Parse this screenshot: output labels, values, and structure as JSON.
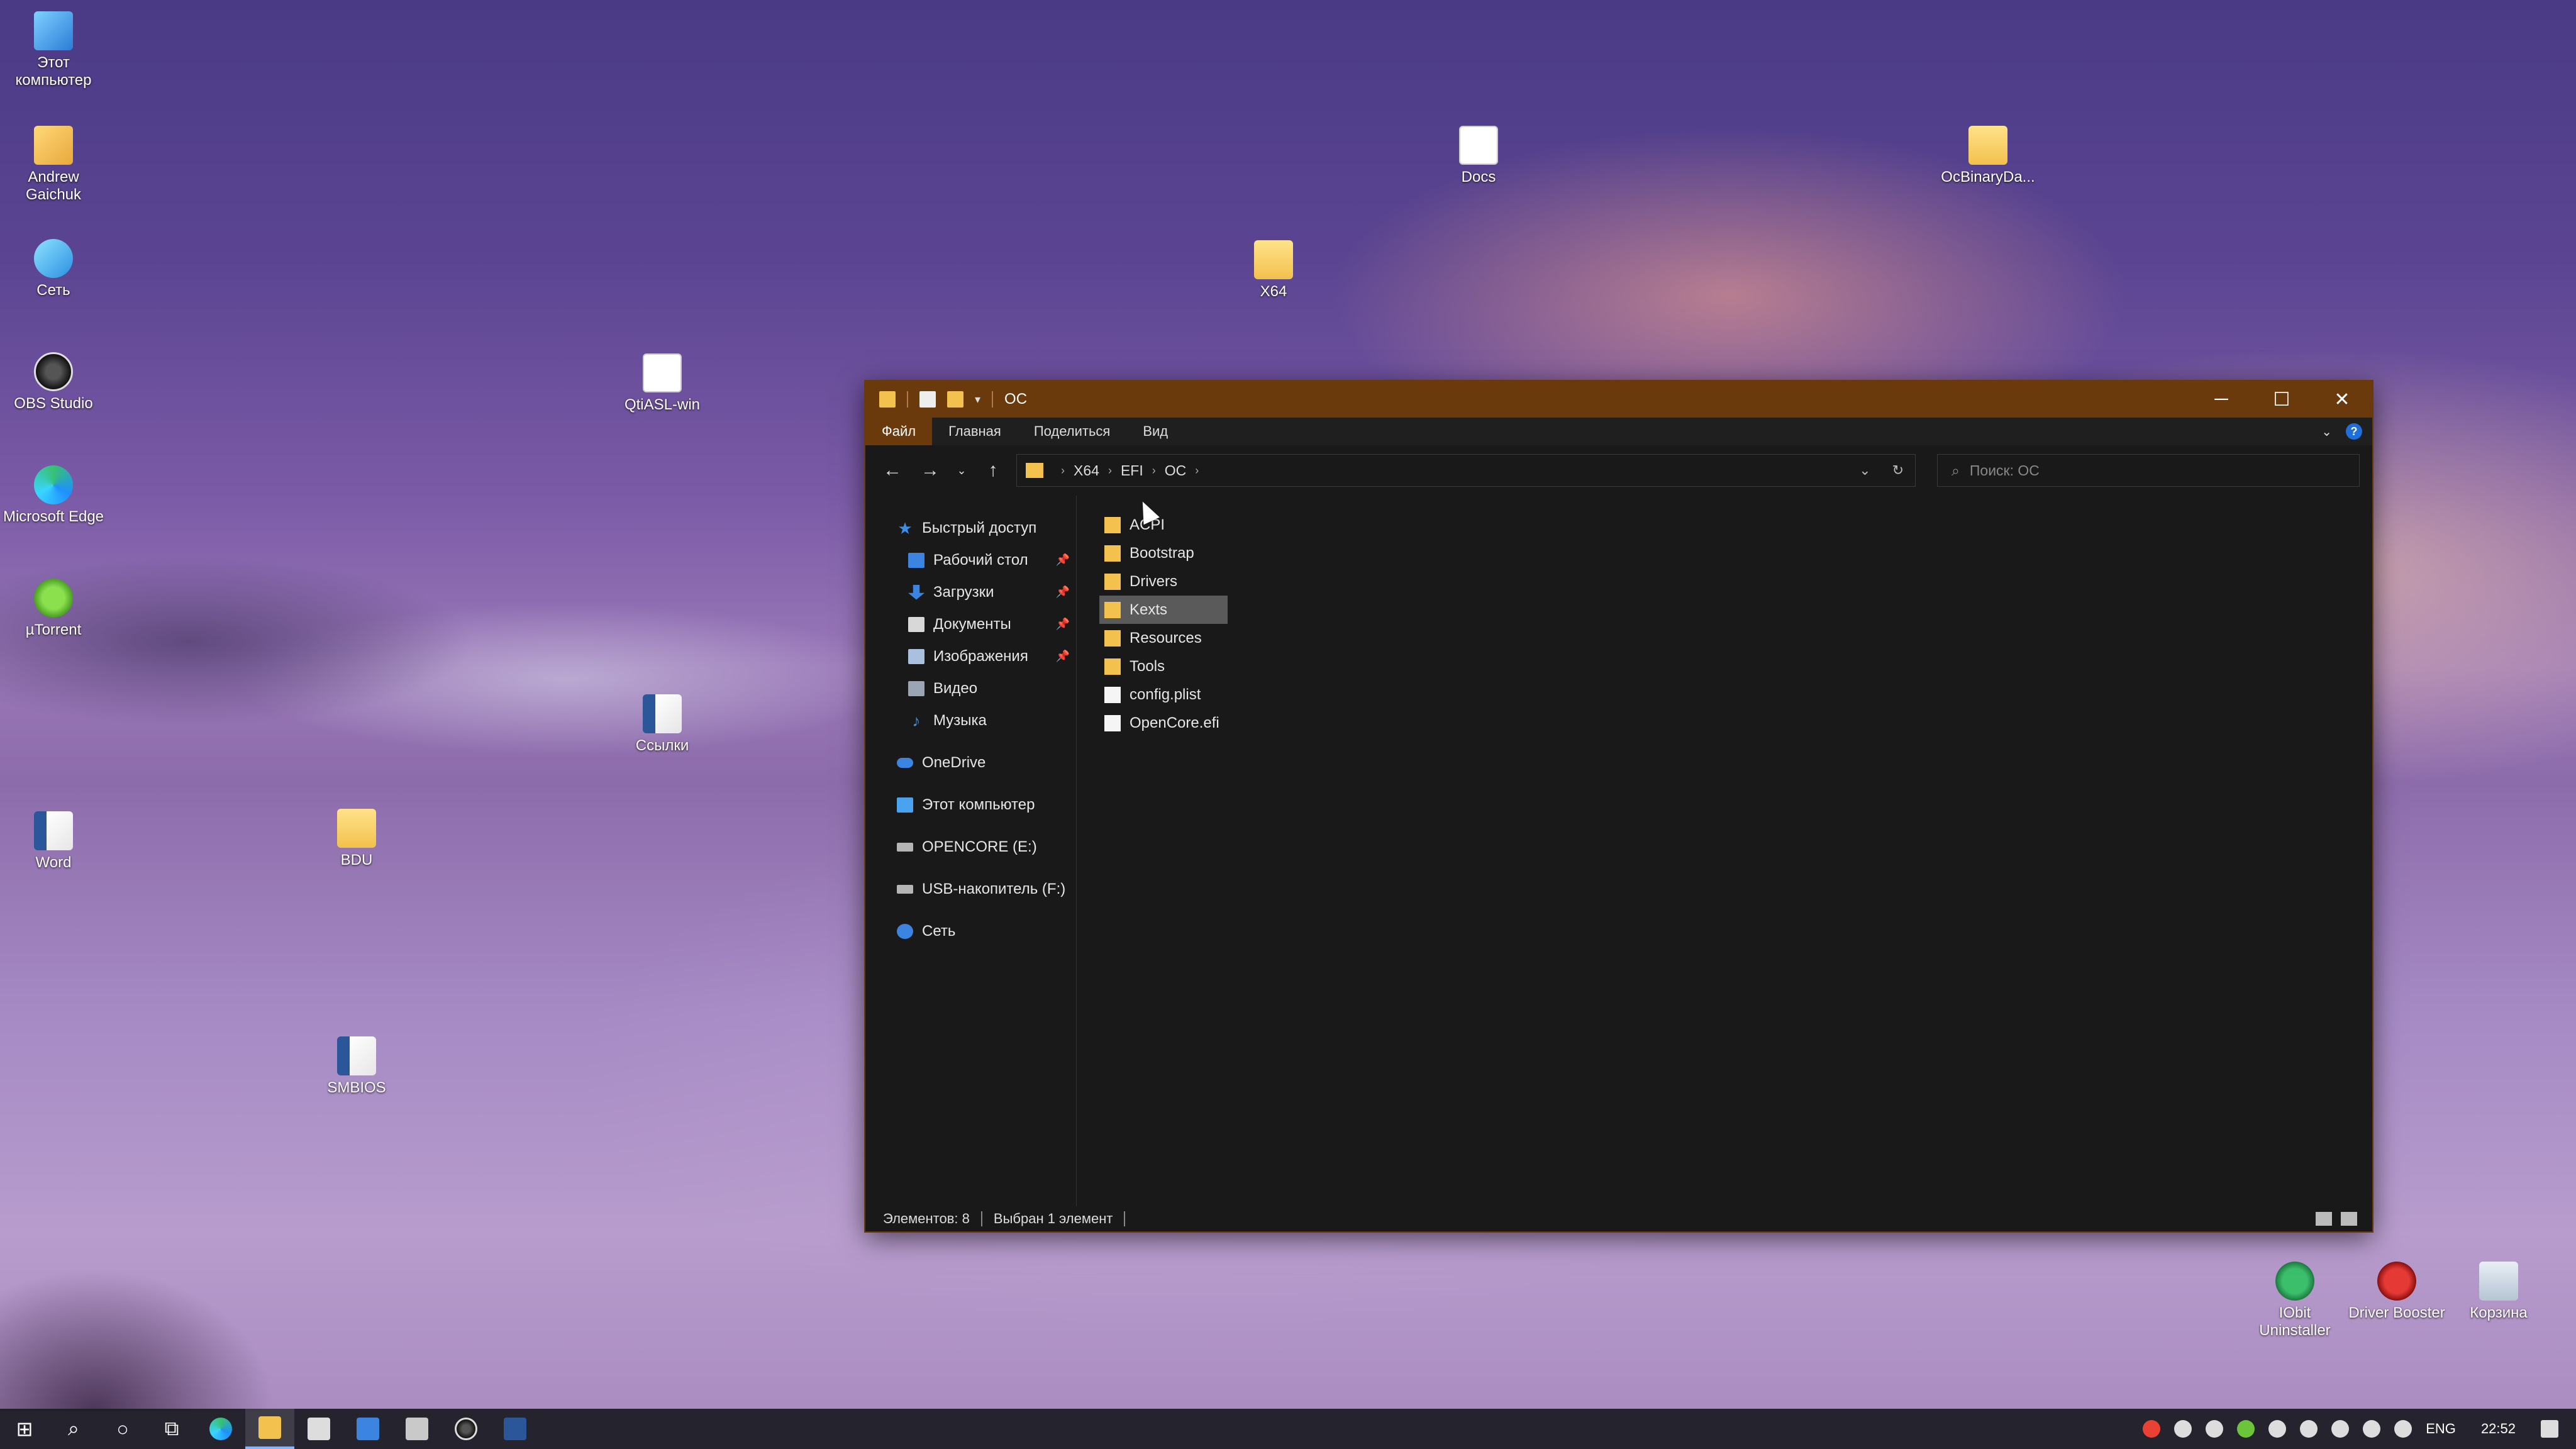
{
  "desktop": {
    "icons_left": [
      {
        "label": "Этот компьютер",
        "icon": "pc-icon"
      },
      {
        "label": "Andrew Gaichuk",
        "icon": "user-folder-icon"
      },
      {
        "label": "Сеть",
        "icon": "network-icon"
      },
      {
        "label": "OBS Studio",
        "icon": "obs-icon"
      },
      {
        "label": "Microsoft Edge",
        "icon": "edge-icon"
      },
      {
        "label": "µTorrent",
        "icon": "utorrent-icon"
      },
      {
        "label": "Word",
        "icon": "word-icon"
      }
    ],
    "icons_mid": [
      {
        "label": "QtiASL-win",
        "icon": "file-icon"
      },
      {
        "label": "Ссылки",
        "icon": "word-doc-icon"
      },
      {
        "label": "BDU",
        "icon": "folder-icon"
      },
      {
        "label": "SMBIOS",
        "icon": "word-doc-icon"
      },
      {
        "label": "X64",
        "icon": "folder-icon"
      },
      {
        "label": "Docs",
        "icon": "pdf-doc-icon"
      },
      {
        "label": "OcBinaryDa...",
        "icon": "folder-icon"
      }
    ],
    "icons_right": [
      {
        "label": "IObit Uninstaller",
        "icon": "iobit-icon"
      },
      {
        "label": "Driver Booster",
        "icon": "driver-booster-icon"
      },
      {
        "label": "Корзина",
        "icon": "recycle-bin-icon"
      }
    ]
  },
  "explorer": {
    "title": "OC",
    "ribbon_tabs": [
      "Файл",
      "Главная",
      "Поделиться",
      "Вид"
    ],
    "breadcrumb": [
      "X64",
      "EFI",
      "OC"
    ],
    "search_placeholder": "Поиск: OC",
    "nav": {
      "quick_access": "Быстрый доступ",
      "quick_items": [
        "Рабочий стол",
        "Загрузки",
        "Документы",
        "Изображения",
        "Видео",
        "Музыка"
      ],
      "onedrive": "OneDrive",
      "this_pc": "Этот компьютер",
      "opencore": "OPENCORE (E:)",
      "usb": "USB-накопитель (F:)",
      "network": "Сеть"
    },
    "files": [
      {
        "name": "ACPI",
        "type": "folder"
      },
      {
        "name": "Bootstrap",
        "type": "folder"
      },
      {
        "name": "Drivers",
        "type": "folder"
      },
      {
        "name": "Kexts",
        "type": "folder",
        "selected": true
      },
      {
        "name": "Resources",
        "type": "folder"
      },
      {
        "name": "Tools",
        "type": "folder"
      },
      {
        "name": "config.plist",
        "type": "file"
      },
      {
        "name": "OpenCore.efi",
        "type": "file"
      }
    ],
    "status": {
      "count": "Элементов: 8",
      "selected": "Выбран 1 элемент"
    }
  },
  "taskbar": {
    "lang": "ENG",
    "time": "22:52"
  },
  "colors": {
    "titlebar": "#6b3a0c",
    "window_bg": "#191919",
    "folder": "#f2c14e",
    "selection": "#5a5a5a"
  }
}
